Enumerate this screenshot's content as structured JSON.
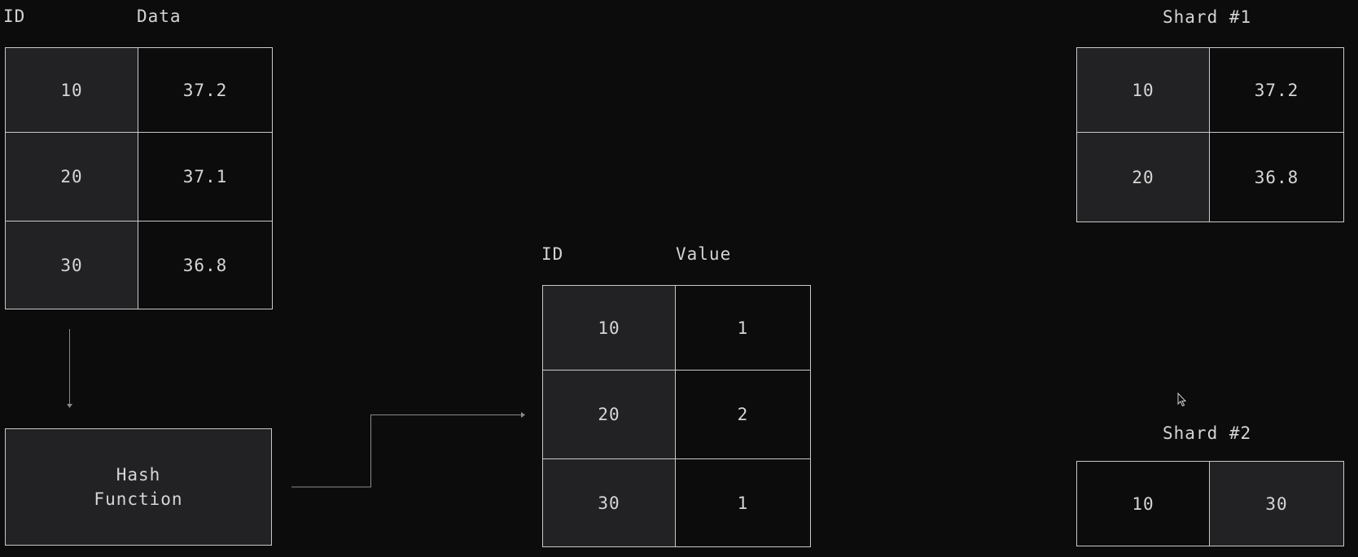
{
  "source_table": {
    "header_id": "ID",
    "header_data": "Data",
    "rows": [
      {
        "id": "10",
        "value": "37.2"
      },
      {
        "id": "20",
        "value": "37.1"
      },
      {
        "id": "30",
        "value": "36.8"
      }
    ]
  },
  "hash_function": {
    "line1": "Hash",
    "line2": "Function"
  },
  "hash_table": {
    "header_id": "ID",
    "header_value": "Value",
    "rows": [
      {
        "id": "10",
        "value": "1"
      },
      {
        "id": "20",
        "value": "2"
      },
      {
        "id": "30",
        "value": "1"
      }
    ]
  },
  "shard1": {
    "title": "Shard #1",
    "rows": [
      {
        "id": "10",
        "value": "37.2"
      },
      {
        "id": "20",
        "value": "36.8"
      }
    ]
  },
  "shard2": {
    "title": "Shard #2",
    "cells": [
      "10",
      "30"
    ]
  },
  "colors": {
    "background": "#0c0c0d",
    "cell_light": "#222224",
    "border": "#c9c9c9",
    "text": "#d6d6d6",
    "arrow": "#8a8a8a"
  }
}
